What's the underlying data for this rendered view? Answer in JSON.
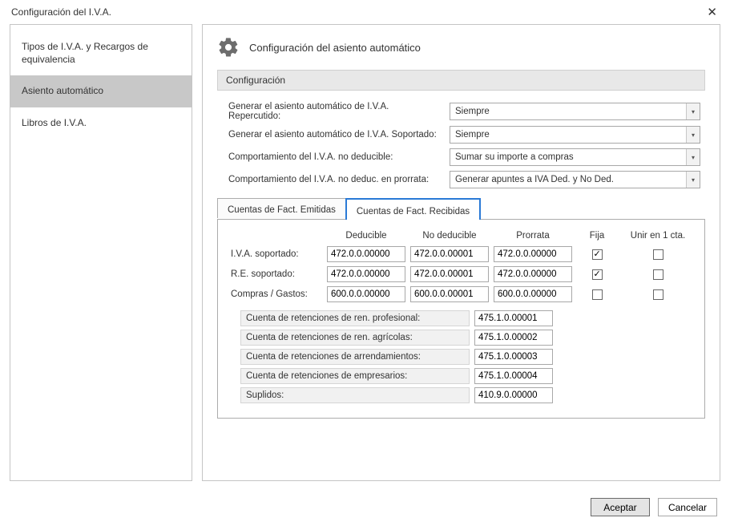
{
  "window": {
    "title": "Configuración del I.V.A."
  },
  "nav": {
    "items": [
      {
        "label": "Tipos de I.V.A. y Recargos de equivalencia",
        "selected": false
      },
      {
        "label": "Asiento automático",
        "selected": true
      },
      {
        "label": "Libros de I.V.A.",
        "selected": false
      }
    ]
  },
  "main": {
    "heading": "Configuración del asiento automático",
    "group_label": "Configuración",
    "rows": [
      {
        "label": "Generar el asiento automático de I.V.A. Repercutido:",
        "value": "Siempre"
      },
      {
        "label": "Generar el asiento automático de I.V.A. Soportado:",
        "value": "Siempre"
      },
      {
        "label": "Comportamiento del I.V.A. no deducible:",
        "value": "Sumar su importe a compras"
      },
      {
        "label": "Comportamiento del I.V.A. no deduc. en prorrata:",
        "value": "Generar apuntes a IVA Ded. y No Ded."
      }
    ],
    "tabs": [
      {
        "label": "Cuentas de Fact. Emitidas",
        "active": false
      },
      {
        "label": "Cuentas de Fact. Recibidas",
        "active": true
      }
    ],
    "grid": {
      "headers": [
        "Deducible",
        "No deducible",
        "Prorrata",
        "Fija",
        "Unir en 1 cta."
      ],
      "rows": [
        {
          "label": "I.V.A. soportado:",
          "ded": "472.0.0.00000",
          "noded": "472.0.0.00001",
          "pro": "472.0.0.00000",
          "fija": true,
          "unir": false
        },
        {
          "label": "R.E. soportado:",
          "ded": "472.0.0.00000",
          "noded": "472.0.0.00001",
          "pro": "472.0.0.00000",
          "fija": true,
          "unir": false
        },
        {
          "label": "Compras / Gastos:",
          "ded": "600.0.0.00000",
          "noded": "600.0.0.00001",
          "pro": "600.0.0.00000",
          "fija": false,
          "unir": false
        }
      ]
    },
    "retentions": [
      {
        "label": "Cuenta de retenciones de ren. profesional:",
        "value": "475.1.0.00001"
      },
      {
        "label": "Cuenta de retenciones de ren. agrícolas:",
        "value": "475.1.0.00002"
      },
      {
        "label": "Cuenta de retenciones de arrendamientos:",
        "value": "475.1.0.00003"
      },
      {
        "label": "Cuenta de retenciones de empresarios:",
        "value": "475.1.0.00004"
      },
      {
        "label": "Suplidos:",
        "value": "410.9.0.00000"
      }
    ]
  },
  "footer": {
    "accept": "Aceptar",
    "cancel": "Cancelar"
  }
}
